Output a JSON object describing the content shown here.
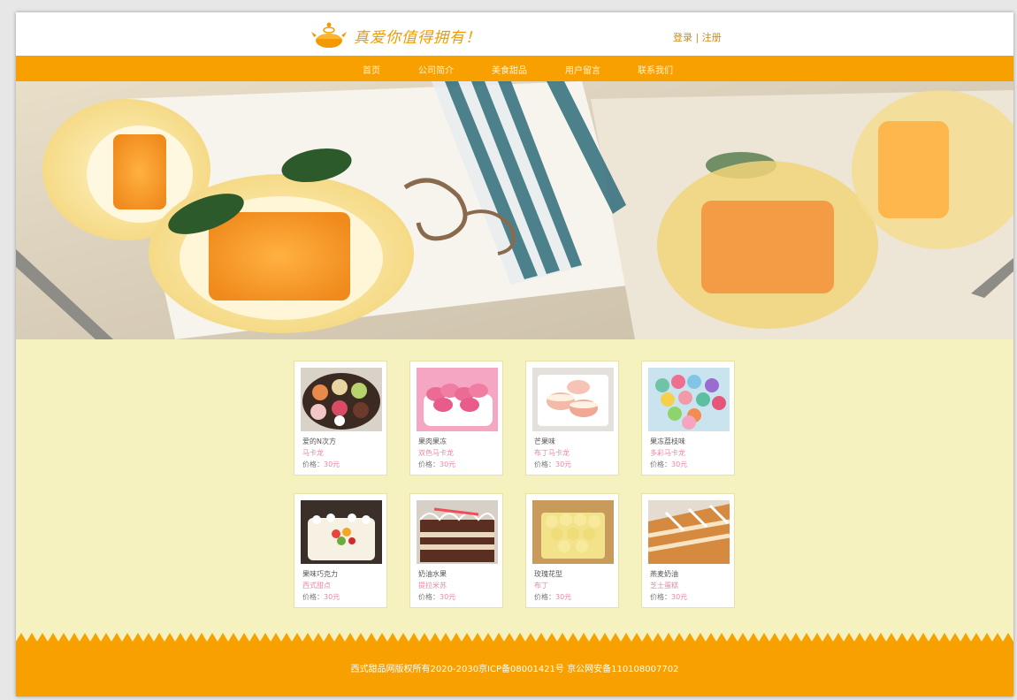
{
  "header": {
    "slogan": "真爱你值得拥有！",
    "login": "登录",
    "separator": " | ",
    "register": "注册"
  },
  "nav": [
    {
      "label": "首页"
    },
    {
      "label": "公司简介"
    },
    {
      "label": "美食甜品"
    },
    {
      "label": "用户留言"
    },
    {
      "label": "联系我们"
    }
  ],
  "products": [
    {
      "name": "爱的N次方",
      "sub": "马卡龙",
      "price_label": "价格：",
      "price": "30元",
      "image": "macaron-box"
    },
    {
      "name": "果肉果冻",
      "sub": "双色马卡龙",
      "price_label": "价格：",
      "price": "30元",
      "image": "pink-macarons"
    },
    {
      "name": "芒果味",
      "sub": "布丁马卡龙",
      "price_label": "价格：",
      "price": "30元",
      "image": "cream-macarons"
    },
    {
      "name": "果冻荔枝味",
      "sub": "多彩马卡龙",
      "price_label": "价格：",
      "price": "30元",
      "image": "colorful-macarons"
    },
    {
      "name": "果味巧克力",
      "sub": "西式甜点",
      "price_label": "价格：",
      "price": "30元",
      "image": "fruit-cake"
    },
    {
      "name": "奶油水果",
      "sub": "提拉米苏",
      "price_label": "价格：",
      "price": "30元",
      "image": "chocolate-cake"
    },
    {
      "name": "玫瑰花型",
      "sub": "布丁",
      "price_label": "价格：",
      "price": "30元",
      "image": "rose-cake"
    },
    {
      "name": "燕麦奶油",
      "sub": "芝士蛋糕",
      "price_label": "价格：",
      "price": "30元",
      "image": "cheese-cake"
    }
  ],
  "footer": {
    "copyright": "西式甜品网版权所有2020-2030京ICP备08001421号  京公网安备110108007702"
  },
  "colors": {
    "accent": "#f7a000",
    "page_bg": "#f6f2bf",
    "price_pink": "#e58aa0"
  }
}
